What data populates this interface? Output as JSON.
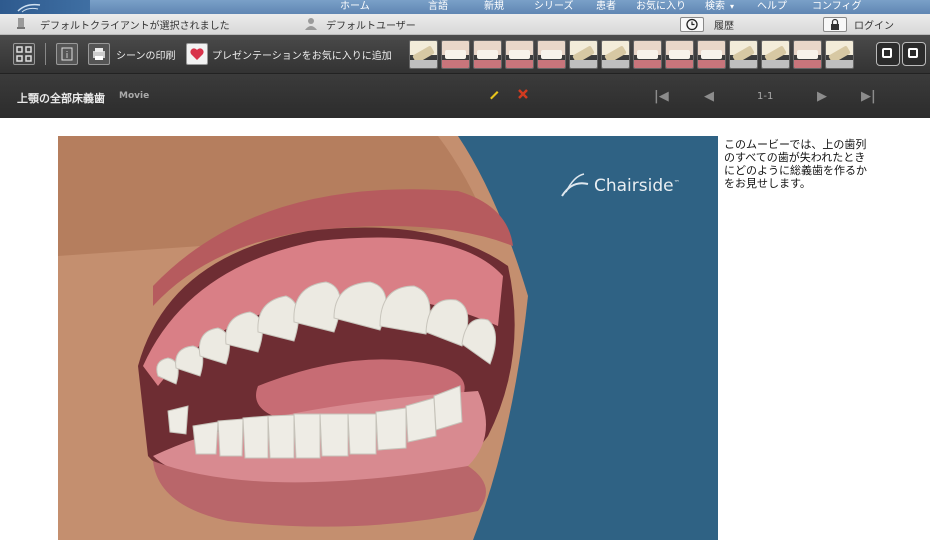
{
  "menu": [
    "ホーム",
    "言語",
    "新規",
    "シリーズ",
    "患者",
    "お気に入り",
    "検索",
    "ヘルプ",
    "コンフィグ"
  ],
  "status": {
    "client": "デフォルトクライアントが選択されました",
    "user": "デフォルトユーザー",
    "history": "履歴",
    "login": "ログイン"
  },
  "toolbar": {
    "print": "シーンの印刷",
    "favorite": "プレゼンテーションをお気に入りに追加",
    "thumbnails": [
      "scene-1",
      "scene-2",
      "scene-3",
      "scene-4",
      "scene-5",
      "scene-6",
      "scene-7",
      "scene-8",
      "scene-9",
      "scene-10",
      "scene-11",
      "scene-12",
      "scene-13",
      "scene-14"
    ]
  },
  "titlebar": {
    "title": "上顎の全部床義歯",
    "subtitle": "Movie",
    "pager": "1-1"
  },
  "video": {
    "brand": "Chairside",
    "tm": "™"
  },
  "description": "このムービーでは、上の歯列のすべての歯が失われたときにどのように総義歯を作るかをお見せします。",
  "colors": {
    "video_bg": "#2f6284",
    "favorite_heart": "#d8324a",
    "edit": "#e8c51b",
    "delete": "#d23b20"
  }
}
